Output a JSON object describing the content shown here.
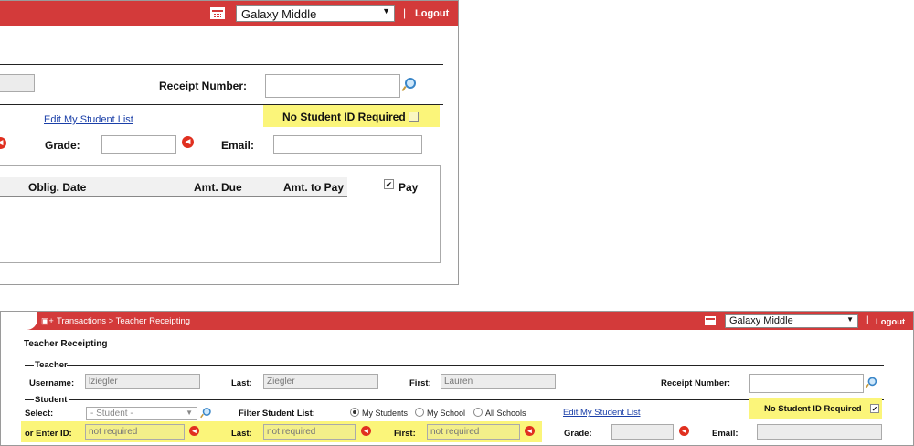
{
  "zoom": {
    "school": "Galaxy Middle",
    "logout": "Logout",
    "separator": "|",
    "receipt_label": "Receipt Number:",
    "no_student_id": "No Student ID Required",
    "edit_list": "Edit My Student List",
    "grade_label": "Grade:",
    "email_label": "Email:",
    "columns": [
      "Oblig. Date",
      "Amt. Due",
      "Amt. to Pay",
      "Pay"
    ]
  },
  "page": {
    "breadcrumb": "Transactions > Teacher Receipting",
    "school": "Galaxy Middle",
    "separator": "|",
    "logout": "Logout",
    "title": "Teacher Receipting",
    "teacher_section": "Teacher",
    "username_label": "Username:",
    "username_value": "lziegler",
    "last_label": "Last:",
    "last_value": "Ziegler",
    "first_label": "First:",
    "first_value": "Lauren",
    "receipt_label": "Receipt Number:",
    "student_section": "Student",
    "select_label": "Select:",
    "select_value": "- Student -",
    "filter_label": "Filter Student List:",
    "radio_options": [
      "My Students",
      "My School",
      "All Schools"
    ],
    "selected_radio": "My Students",
    "edit_list": "Edit My Student List",
    "no_student_id": "No Student ID Required",
    "enter_id_label": "or Enter ID:",
    "enter_id_value": "not required",
    "last2_label": "Last:",
    "last2_value": "not required",
    "first2_label": "First:",
    "first2_value": "not required",
    "grade_label": "Grade:",
    "email_label": "Email:"
  }
}
